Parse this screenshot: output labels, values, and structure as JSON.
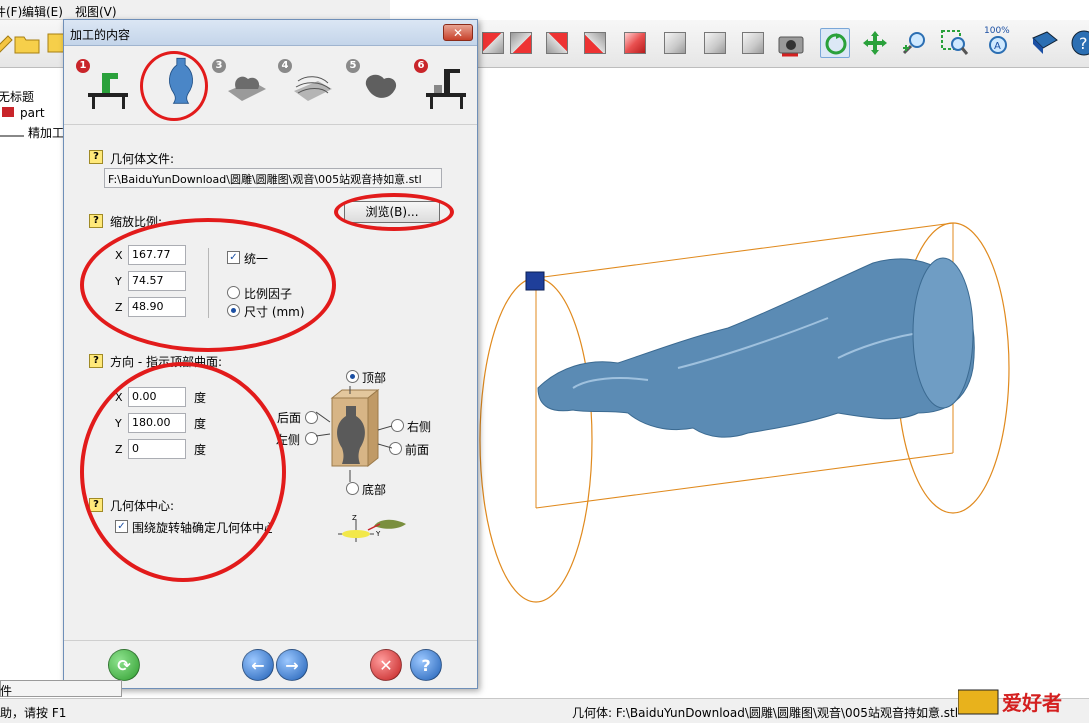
{
  "app": {
    "menu": [
      "件(F)",
      "编辑(E)",
      "视图(V)"
    ],
    "tree": {
      "root": "无标题",
      "items": [
        "part",
        "精加工"
      ]
    },
    "status": {
      "help_text": "助，请按 F1",
      "geometry_text": "几何体: F:\\BaiduYunDownload\\圆雕\\圆雕图\\观音\\005站观音持如意.stl",
      "bottom_left": "件"
    },
    "zoom_label": "100%",
    "brand": "爱好者"
  },
  "dialog": {
    "title": "加工的内容",
    "close_symbol": "✕",
    "steps": [
      "1",
      "2",
      "3",
      "4",
      "5",
      "6"
    ],
    "geometry_file": {
      "label": "几何体文件:",
      "path": "F:\\BaiduYunDownload\\圆雕\\圆雕图\\观音\\005站观音持如意.stl",
      "browse_label": "浏览(B)..."
    },
    "scale": {
      "label": "缩放比例:",
      "x_label": "X",
      "x_value": "167.77",
      "y_label": "Y",
      "y_value": "74.57",
      "z_label": "Z",
      "z_value": "48.90",
      "uniform_label": "统一",
      "uniform_checked": true,
      "factor_label": "比例因子",
      "size_label": "尺寸 (mm)",
      "selected_mode": "size"
    },
    "orientation": {
      "label": "方向 - 指示顶部曲面:",
      "x_label": "X",
      "x_value": "0.00",
      "y_label": "Y",
      "y_value": "180.00",
      "z_label": "Z",
      "z_value": "0",
      "unit": "度",
      "top_label": "顶部",
      "back_label": "后面",
      "left_label": "左侧",
      "right_label": "右侧",
      "front_label": "前面",
      "bottom_label": "底部",
      "selected_face": "top"
    },
    "center": {
      "label": "几何体中心:",
      "checkbox_label": "围绕旋转轴确定几何体中心",
      "checked": true,
      "axis_z": "Z",
      "axis_y": "Y"
    },
    "help_symbol": "?",
    "check_symbol": "✓"
  },
  "colors": {
    "annotation": "#e21b1b",
    "model": "#5b8bb4",
    "bounding": "#e08a1e",
    "accent": "#1b4fa3"
  }
}
